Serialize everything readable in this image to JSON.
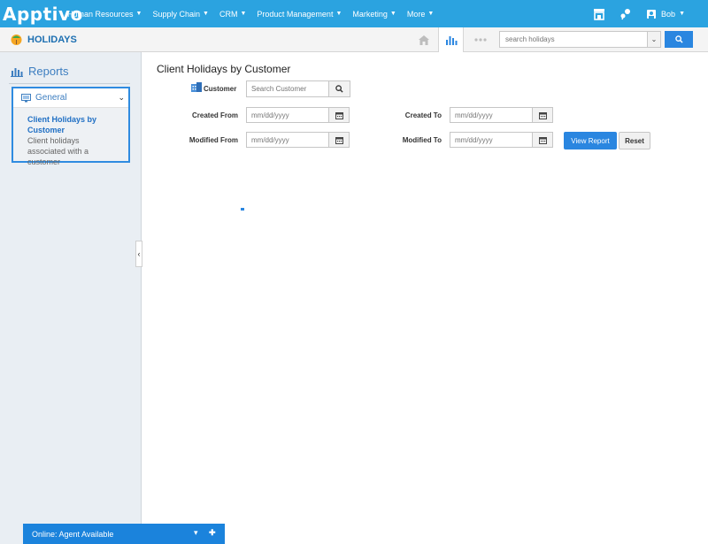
{
  "topnav": {
    "logo": "Apptivo",
    "menu": [
      {
        "label": "Human Resources"
      },
      {
        "label": "Supply Chain"
      },
      {
        "label": "CRM"
      },
      {
        "label": "Product Management"
      },
      {
        "label": "Marketing"
      },
      {
        "label": "More"
      }
    ],
    "user": "Bob"
  },
  "subheader": {
    "app_title": "HOLIDAYS",
    "search_placeholder": "search holidays"
  },
  "sidebar": {
    "title": "Reports",
    "panel": {
      "heading": "General",
      "link": "Client Holidays by Customer",
      "description": "Client holidays associated with a customer"
    }
  },
  "main": {
    "title": "Client Holidays by Customer",
    "customer_label": "Customer",
    "customer_placeholder": "Search Customer",
    "created_from_label": "Created From",
    "created_to_label": "Created To",
    "modified_from_label": "Modified From",
    "modified_to_label": "Modified To",
    "date_placeholder": "mm/dd/yyyy",
    "view_report": "View Report",
    "reset": "Reset"
  },
  "chat": {
    "status": "Online: Agent Available"
  },
  "colors": {
    "nav": "#2ba3e0",
    "accent": "#2a86e0",
    "sidebar_bg": "#e9eef3"
  }
}
